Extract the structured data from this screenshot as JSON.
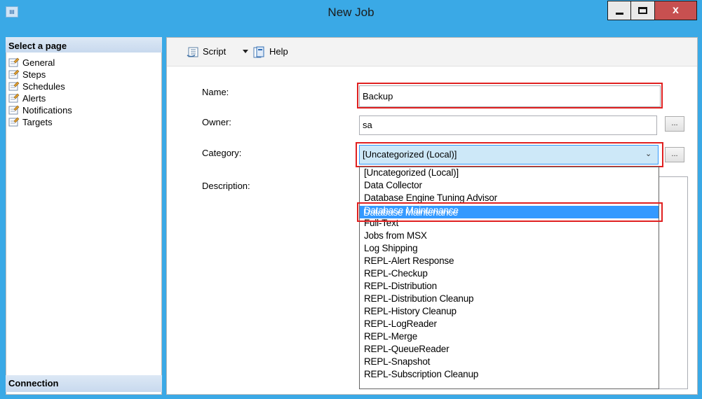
{
  "window": {
    "title": "New Job",
    "app_icon": "dialog-icon",
    "close_glyph": "x"
  },
  "left_pane": {
    "header": "Select a page",
    "pages": [
      {
        "label": "General",
        "icon": "wrench-page-icon"
      },
      {
        "label": "Steps",
        "icon": "wrench-page-icon"
      },
      {
        "label": "Schedules",
        "icon": "wrench-page-icon"
      },
      {
        "label": "Alerts",
        "icon": "wrench-page-icon"
      },
      {
        "label": "Notifications",
        "icon": "wrench-page-icon"
      },
      {
        "label": "Targets",
        "icon": "wrench-page-icon"
      }
    ],
    "connection_header": "Connection"
  },
  "toolbar": {
    "script_label": "Script",
    "help_label": "Help"
  },
  "form": {
    "name_label": "Name:",
    "name_value": "Backup",
    "owner_label": "Owner:",
    "owner_value": "sa",
    "category_label": "Category:",
    "category_value": "[Uncategorized (Local)]",
    "description_label": "Description:",
    "ellipsis": "..."
  },
  "category_options": [
    "[Uncategorized (Local)]",
    "Data Collector",
    "Database Engine Tuning Advisor",
    "Database Maintenance",
    "Full-Text",
    "Jobs from MSX",
    "Log Shipping",
    "REPL-Alert Response",
    "REPL-Checkup",
    "REPL-Distribution",
    "REPL-Distribution Cleanup",
    "REPL-History Cleanup",
    "REPL-LogReader",
    "REPL-Merge",
    "REPL-QueueReader",
    "REPL-Snapshot",
    "REPL-Subscription Cleanup"
  ],
  "selected_option_index": 3,
  "colors": {
    "titlebar": "#3aa9e6",
    "close_button": "#c75050",
    "selection": "#3399ff",
    "highlight_box": "#e02020"
  }
}
